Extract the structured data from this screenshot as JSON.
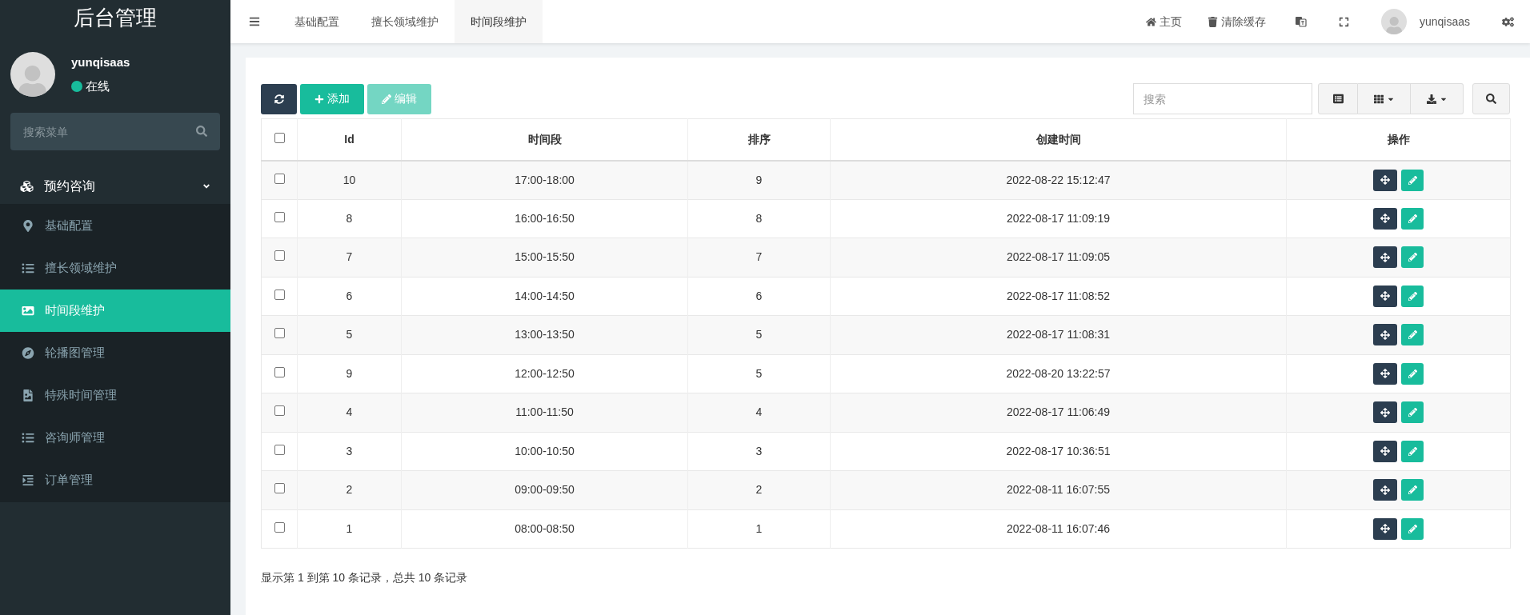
{
  "sidebar": {
    "title": "后台管理",
    "user": {
      "name": "yunqisaas",
      "status": "在线",
      "online": true
    },
    "search": {
      "placeholder": "搜索菜单"
    },
    "menu": {
      "label": "预约咨询",
      "expanded": true,
      "children": [
        {
          "label": "基础配置",
          "selected": false
        },
        {
          "label": "擅长领域维护",
          "selected": false
        },
        {
          "label": "时间段维护",
          "selected": true
        },
        {
          "label": "轮播图管理",
          "selected": false
        },
        {
          "label": "特殊时间管理",
          "selected": false
        },
        {
          "label": "咨询师管理",
          "selected": false
        },
        {
          "label": "订单管理",
          "selected": false
        }
      ]
    }
  },
  "topbar": {
    "tabs": [
      {
        "label": "基础配置",
        "selected": false
      },
      {
        "label": "擅长领域维护",
        "selected": false
      },
      {
        "label": "时间段维护",
        "selected": true
      }
    ],
    "links": [
      {
        "label": "主页"
      },
      {
        "label": "清除缓存"
      }
    ],
    "user": "yunqisaas"
  },
  "toolbar": {
    "buttons": [
      {
        "kind": "refresh",
        "disabled": false
      },
      {
        "kind": "add",
        "label": "添加",
        "disabled": false
      },
      {
        "kind": "edit",
        "label": "编辑",
        "disabled": true
      }
    ],
    "search": {
      "placeholder": "搜索"
    }
  },
  "table": {
    "all_checked": false,
    "columns": [
      "Id",
      "时间段",
      "排序",
      "创建时间",
      "操作"
    ],
    "rows": [
      {
        "id": "10",
        "period": "17:00-18:00",
        "sort": "9",
        "created": "2022-08-22 15:12:47",
        "checked": false
      },
      {
        "id": "8",
        "period": "16:00-16:50",
        "sort": "8",
        "created": "2022-08-17 11:09:19",
        "checked": false
      },
      {
        "id": "7",
        "period": "15:00-15:50",
        "sort": "7",
        "created": "2022-08-17 11:09:05",
        "checked": false
      },
      {
        "id": "6",
        "period": "14:00-14:50",
        "sort": "6",
        "created": "2022-08-17 11:08:52",
        "checked": false
      },
      {
        "id": "5",
        "period": "13:00-13:50",
        "sort": "5",
        "created": "2022-08-17 11:08:31",
        "checked": false
      },
      {
        "id": "9",
        "period": "12:00-12:50",
        "sort": "5",
        "created": "2022-08-20 13:22:57",
        "checked": false
      },
      {
        "id": "4",
        "period": "11:00-11:50",
        "sort": "4",
        "created": "2022-08-17 11:06:49",
        "checked": false
      },
      {
        "id": "3",
        "period": "10:00-10:50",
        "sort": "3",
        "created": "2022-08-17 10:36:51",
        "checked": false
      },
      {
        "id": "2",
        "period": "09:00-09:50",
        "sort": "2",
        "created": "2022-08-11 16:07:55",
        "checked": false
      },
      {
        "id": "1",
        "period": "08:00-08:50",
        "sort": "1",
        "created": "2022-08-11 16:07:46",
        "checked": false
      }
    ]
  },
  "pagination": {
    "summary": "显示第 1 到第 10 条记录，总共 10 条记录"
  }
}
